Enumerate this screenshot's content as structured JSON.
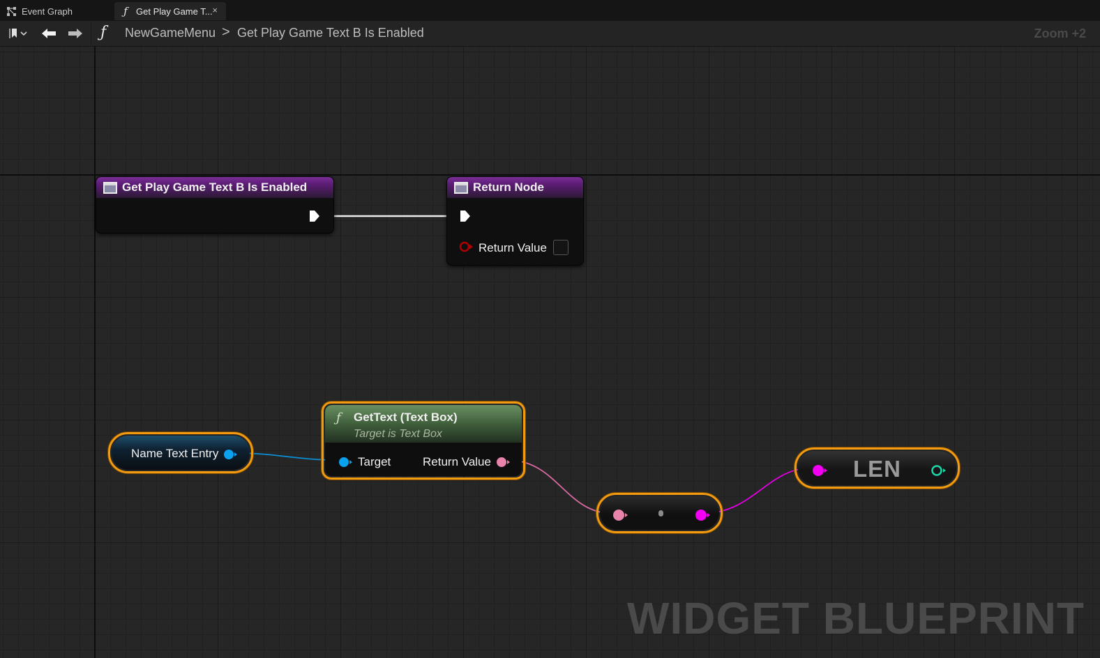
{
  "tabs": [
    {
      "label": "Event Graph",
      "icon": "event-graph-icon"
    },
    {
      "label": "Get Play Game T...",
      "icon": "function-icon",
      "close": "×"
    }
  ],
  "breadcrumb": {
    "fn_glyph": "ƒ",
    "root": "NewGameMenu",
    "separator": ">",
    "leaf": "Get Play Game Text B Is Enabled"
  },
  "zoom": "Zoom +2",
  "nodes": {
    "entry": {
      "title": "Get Play Game Text B Is Enabled"
    },
    "return": {
      "title": "Return Node",
      "return_value_label": "Return Value",
      "return_value_checked": false
    },
    "variable": {
      "label": "Name Text Entry"
    },
    "get_text": {
      "fn_glyph": "ƒ",
      "title": "GetText (Text Box)",
      "subtitle": "Target is Text Box",
      "target_label": "Target",
      "return_label": "Return Value"
    },
    "len": {
      "title": "LEN"
    }
  },
  "watermark": "WIDGET BLUEPRINT",
  "colors": {
    "exec": "#ffffff",
    "boolean": "#a00000",
    "object": "#0aa2ee",
    "text": "#e883ac",
    "string": "#f200f2",
    "integer": "#1dd6a8",
    "selection": "#f29a10"
  }
}
